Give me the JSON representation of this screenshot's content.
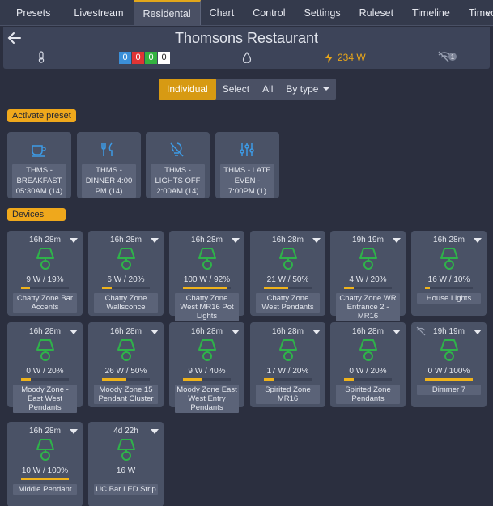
{
  "tabs": [
    "Presets",
    "Livestream",
    "Residental",
    "Chart",
    "Control",
    "Settings",
    "Ruleset",
    "Timeline",
    "Timechart"
  ],
  "active_tab": "Residental",
  "header": {
    "title": "Thomsons Restaurant",
    "counts": [
      {
        "value": "0",
        "color": "#3b8fd8"
      },
      {
        "value": "0",
        "color": "#e03434"
      },
      {
        "value": "0",
        "color": "#33b340"
      },
      {
        "value": "0",
        "color": "#ffffff"
      }
    ],
    "power": "234 W",
    "badge": "1"
  },
  "filters": [
    {
      "label": "Individual",
      "active": true
    },
    {
      "label": "Select",
      "active": false
    },
    {
      "label": "All",
      "active": false
    },
    {
      "label": "By type",
      "active": false,
      "dropdown": true
    }
  ],
  "sections": {
    "presets_label": "Activate preset",
    "devices_label": "Devices"
  },
  "presets": [
    {
      "icon": "coffee-cup-icon",
      "label": "THMS - BREAKFAST 05:30AM (14)"
    },
    {
      "icon": "fork-knife-icon",
      "label": "THMS - DINNER 4:00 PM (14)"
    },
    {
      "icon": "light-off-icon",
      "label": "THMS - LIGHTS OFF 2:00AM (14)"
    },
    {
      "icon": "sliders-icon",
      "label": "THMS - LATE EVEN - 7:00PM (1)"
    }
  ],
  "devices": [
    {
      "time": "16h 28m",
      "power": "9 W / 19%",
      "level": 19,
      "name": "Chatty Zone Bar Accents",
      "offline": false
    },
    {
      "time": "16h 28m",
      "power": "6 W / 20%",
      "level": 20,
      "name": "Chatty Zone Wallsconce",
      "offline": false
    },
    {
      "time": "16h 28m",
      "power": "100 W / 92%",
      "level": 92,
      "name": "Chatty Zone West MR16 Pot Lights",
      "offline": false
    },
    {
      "time": "16h 28m",
      "power": "21 W / 50%",
      "level": 50,
      "name": "Chatty Zone West Pendants",
      "offline": false
    },
    {
      "time": "19h 19m",
      "power": "4 W / 20%",
      "level": 20,
      "name": "Chatty Zone WR Entrance 2 - MR16",
      "offline": false
    },
    {
      "time": "16h 28m",
      "power": "16 W / 10%",
      "level": 10,
      "name": "House Lights",
      "offline": false
    },
    {
      "time": "16h 28m",
      "power": "0 W / 20%",
      "level": 20,
      "name": "Moody Zone - East West Pendants",
      "offline": false
    },
    {
      "time": "16h 28m",
      "power": "26 W / 50%",
      "level": 50,
      "name": "Moody Zone 15 Pendant Cluster",
      "offline": false
    },
    {
      "time": "16h 28m",
      "power": "9 W / 40%",
      "level": 40,
      "name": "Moody Zone East West Entry Pendants",
      "offline": false
    },
    {
      "time": "16h 28m",
      "power": "17 W / 20%",
      "level": 20,
      "name": "Spirited Zone MR16",
      "offline": false
    },
    {
      "time": "16h 28m",
      "power": "0 W / 20%",
      "level": 20,
      "name": "Spirited Zone Pendants",
      "offline": false
    },
    {
      "time": "19h 19m",
      "power": "0 W / 100%",
      "level": 100,
      "name": "Dimmer 7",
      "offline": true
    },
    {
      "time": "16h 28m",
      "power": "10 W / 100%",
      "level": 100,
      "name": "Middle Pendant",
      "offline": false
    },
    {
      "time": "4d 22h",
      "power": "16 W",
      "level": null,
      "name": "UC Bar LED Strip",
      "offline": false
    }
  ],
  "colors": {
    "accent": "#efa81c",
    "bulb": "#2fb34a",
    "icon_blue": "#3d9be6"
  }
}
